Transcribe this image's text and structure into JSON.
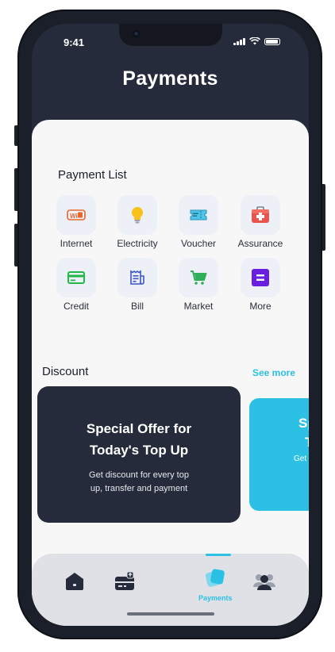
{
  "status": {
    "time": "9:41"
  },
  "header": {
    "title": "Payments"
  },
  "payment_list": {
    "title": "Payment List",
    "items": [
      {
        "label": "Internet",
        "icon": "wifi-icon"
      },
      {
        "label": "Electricity",
        "icon": "lightbulb-icon"
      },
      {
        "label": "Voucher",
        "icon": "ticket-icon"
      },
      {
        "label": "Assurance",
        "icon": "medical-kit-icon"
      },
      {
        "label": "Credit",
        "icon": "credit-card-icon"
      },
      {
        "label": "Bill",
        "icon": "receipt-icon"
      },
      {
        "label": "Market",
        "icon": "shopping-cart-icon"
      },
      {
        "label": "More",
        "icon": "more-icon"
      }
    ]
  },
  "discount": {
    "title": "Discount",
    "see_more": "See more",
    "offers": [
      {
        "title_line1": "Special Offer for",
        "title_line2": "Today's Top Up",
        "subtitle_line1": "Get discount for every top",
        "subtitle_line2": "up, transfer and payment"
      },
      {
        "title_line1": "Sp",
        "title_line2": "T",
        "subtitle_line1": "Get"
      }
    ]
  },
  "tabbar": {
    "tabs": [
      {
        "name": "home",
        "label": ""
      },
      {
        "name": "wallet",
        "label": ""
      },
      {
        "name": "payments",
        "label": "Payments",
        "active": true
      },
      {
        "name": "contacts",
        "label": ""
      }
    ]
  },
  "colors": {
    "navy": "#252b3b",
    "accent": "#2bc0e4",
    "sheet": "#f7f7f8",
    "tabbar": "#dfe1e6"
  }
}
